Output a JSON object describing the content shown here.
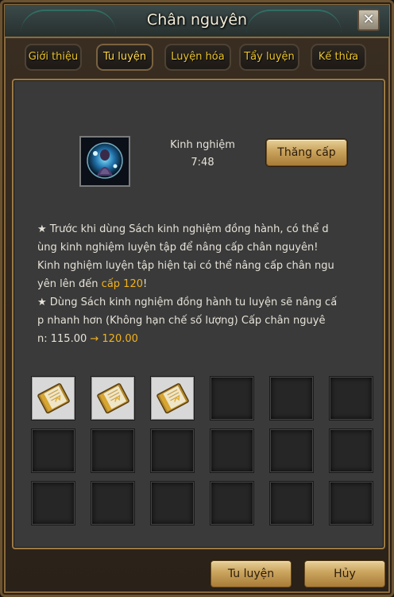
{
  "window": {
    "title": "Chân nguyên",
    "close_label": "✕"
  },
  "tabs": [
    {
      "label": "Giới thiệu"
    },
    {
      "label": "Tu luyện"
    },
    {
      "label": "Luyện hóa"
    },
    {
      "label": "Tẩy luyện"
    },
    {
      "label": "Kế thừa"
    }
  ],
  "experience": {
    "label": "Kinh nghiệm",
    "value": "7:48",
    "level_up_label": "Thăng cấp"
  },
  "description": {
    "line1": "★  Trước khi dùng Sách kinh nghiệm đồng hành, có thể d",
    "line2": "ùng kinh nghiệm luyện tập để nâng cấp chân nguyên!",
    "line3": "   Kinh nghiệm luyện tập hiện tại có thể nâng cấp chân ngu",
    "line4_pre": "yên lên đến ",
    "line4_hl": "cấp 120",
    "line4_post": "!",
    "line5": "★  Dùng Sách kinh nghiệm đồng hành tu luyện sẽ nâng cấ",
    "line6": "p nhanh hơn (Không hạn chế số lượng)   Cấp chân nguyê",
    "line7_pre": "n:  115.00 ",
    "line7_arrow": "→",
    "line7_hl": " 120.00"
  },
  "slots": [
    {
      "item": "exp-book"
    },
    {
      "item": "exp-book"
    },
    {
      "item": "exp-book"
    },
    {
      "item": ""
    },
    {
      "item": ""
    },
    {
      "item": ""
    },
    {
      "item": ""
    },
    {
      "item": ""
    },
    {
      "item": ""
    },
    {
      "item": ""
    },
    {
      "item": ""
    },
    {
      "item": ""
    },
    {
      "item": ""
    },
    {
      "item": ""
    },
    {
      "item": ""
    },
    {
      "item": ""
    },
    {
      "item": ""
    },
    {
      "item": ""
    }
  ],
  "footer": {
    "train_label": "Tu luyện",
    "cancel_label": "Hủy"
  },
  "colors": {
    "accent_gold": "#f2b21c",
    "tab_text": "#e8c22a",
    "panel_bg": "#3a3a3a"
  }
}
